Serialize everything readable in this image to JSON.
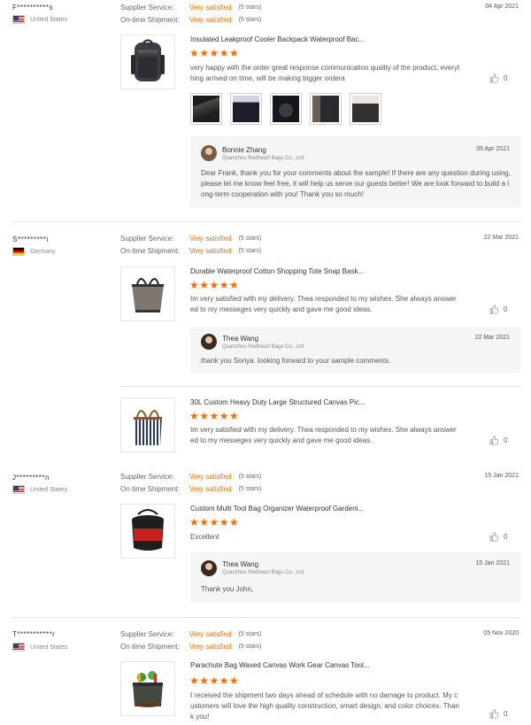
{
  "labels": {
    "supplier_service": "Supplier Service:",
    "on_time_shipment": "On-time Shipment:",
    "very_satisfied": "Very satisfied",
    "five_stars": "(5 stars)",
    "stars": "★★★★★",
    "company": "Quanzhou Redheart Bags Co., Ltd."
  },
  "reviews": [
    {
      "name": "F**********s",
      "country": "United States",
      "flag": "us",
      "date": "04 Apr 2021",
      "products": [
        {
          "title": "Insulated Leakproof Cooler Backpack Waterproof Bac...",
          "text": "very happy with the order great response communication quality of the product, everything arrived on time, will be making bigger ordera",
          "helpful": "0",
          "photos_count": 5
        }
      ],
      "reply": {
        "name": "Bonnie Zhang",
        "date": "05 Apr 2021",
        "text": "Dear Frank, thank you for your comments about the sample! If there are any question during using, please let me know feel free, it will help us serve our guests better! We are look forward to build a long-term cooperation with you! Thank you so much!"
      }
    },
    {
      "name": "S*********i",
      "country": "Germany",
      "flag": "de",
      "date": "22 Mar 2021",
      "products": [
        {
          "title": "Durable Waterproof Cotton Shopping Tote Snap Bask...",
          "text": "Im very satisfied with my delivery. Thea responded to my wishes. She always answered to my messeges very quickly and gave me good ideas.",
          "helpful": "0"
        },
        {
          "title": "30L Custom Heavy Duty Large Structured Canvas Pic...",
          "text": "Im very satisfied with my delivery. Thea responded to my wishes. She always answered to my messeges very quickly and gave me good ideas.",
          "helpful": "0"
        }
      ],
      "reply": {
        "name": "Thea Wang",
        "date": "22 Mar 2021",
        "text": "thank you Sonya. looking forward to your sample comments."
      }
    },
    {
      "name": "J*********n",
      "country": "United States",
      "flag": "us",
      "date": "15 Jan 2021",
      "products": [
        {
          "title": "Custom Multi Tool Bag Organizer Waterproof Gardeni...",
          "text": "Excellent",
          "helpful": "0"
        }
      ],
      "reply": {
        "name": "Thea Wang",
        "date": "15 Jan 2021",
        "text": "Thank you John,"
      }
    },
    {
      "name": "T***********r",
      "country": "United States",
      "flag": "us",
      "date": "05 Nov 2020",
      "products": [
        {
          "title": "Parachute Bag Waxed Canvas Work Gear Canvas Tool...",
          "text": "I received the shipment two days ahead of schedule with no damage to product. My customers will love the high quality construction, smart design, and color choices. Thank you!",
          "helpful": "0"
        }
      ]
    }
  ]
}
